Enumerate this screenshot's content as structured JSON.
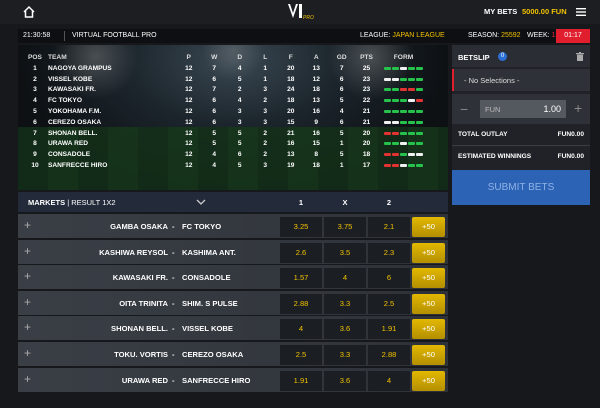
{
  "nav": {
    "my_bets": "MY BETS",
    "balance": "5000.00 FUN",
    "logo_sub": "PRO"
  },
  "header": {
    "clock": "21:30:58",
    "title": "VIRTUAL FOOTBALL PRO",
    "league_label": "LEAGUE:",
    "league_value": "JAPAN LEAGUE",
    "season_label": "SEASON:",
    "season_value": "25592",
    "week_label": "WEEK:",
    "week_value": "13",
    "timer": "01:17"
  },
  "league_table": {
    "headers": [
      "POS",
      "TEAM",
      "P",
      "W",
      "D",
      "L",
      "F",
      "A",
      "GD",
      "PTS",
      "FORM"
    ],
    "rows": [
      {
        "pos": "1",
        "team": "NAGOYA GRAMPUS",
        "p": "12",
        "w": "7",
        "d": "4",
        "l": "1",
        "f": "20",
        "a": "13",
        "gd": "7",
        "pts": "25",
        "form": [
          "W",
          "W",
          "D",
          "W",
          "W"
        ]
      },
      {
        "pos": "2",
        "team": "VISSEL KOBE",
        "p": "12",
        "w": "6",
        "d": "5",
        "l": "1",
        "f": "18",
        "a": "12",
        "gd": "6",
        "pts": "23",
        "form": [
          "D",
          "D",
          "W",
          "W",
          "W"
        ]
      },
      {
        "pos": "3",
        "team": "KAWASAKI FR.",
        "p": "12",
        "w": "7",
        "d": "2",
        "l": "3",
        "f": "24",
        "a": "18",
        "gd": "6",
        "pts": "23",
        "form": [
          "W",
          "W",
          "L",
          "L",
          "W"
        ]
      },
      {
        "pos": "4",
        "team": "FC TOKYO",
        "p": "12",
        "w": "6",
        "d": "4",
        "l": "2",
        "f": "18",
        "a": "13",
        "gd": "5",
        "pts": "22",
        "form": [
          "W",
          "W",
          "W",
          "D",
          "L"
        ]
      },
      {
        "pos": "5",
        "team": "YOKOHAMA F.M.",
        "p": "12",
        "w": "6",
        "d": "3",
        "l": "3",
        "f": "20",
        "a": "16",
        "gd": "4",
        "pts": "21",
        "form": [
          "W",
          "W",
          "W",
          "W",
          "W"
        ]
      },
      {
        "pos": "6",
        "team": "CEREZO OSAKA",
        "p": "12",
        "w": "6",
        "d": "3",
        "l": "3",
        "f": "15",
        "a": "9",
        "gd": "6",
        "pts": "21",
        "form": [
          "D",
          "D",
          "W",
          "W",
          "W"
        ]
      },
      {
        "pos": "7",
        "team": "SHONAN BELL.",
        "p": "12",
        "w": "5",
        "d": "5",
        "l": "2",
        "f": "21",
        "a": "16",
        "gd": "5",
        "pts": "20",
        "form": [
          "L",
          "L",
          "W",
          "W",
          "W"
        ]
      },
      {
        "pos": "8",
        "team": "URAWA RED",
        "p": "12",
        "w": "5",
        "d": "5",
        "l": "2",
        "f": "16",
        "a": "15",
        "gd": "1",
        "pts": "20",
        "form": [
          "W",
          "W",
          "D",
          "W",
          "W"
        ]
      },
      {
        "pos": "9",
        "team": "CONSADOLE",
        "p": "12",
        "w": "4",
        "d": "6",
        "l": "2",
        "f": "13",
        "a": "8",
        "gd": "5",
        "pts": "18",
        "form": [
          "L",
          "L",
          "W",
          "D",
          "D"
        ]
      },
      {
        "pos": "10",
        "team": "SANFRECCE HIRO",
        "p": "12",
        "w": "4",
        "d": "5",
        "l": "3",
        "f": "19",
        "a": "18",
        "gd": "1",
        "pts": "17",
        "form": [
          "L",
          "L",
          "D",
          "W",
          "W"
        ]
      }
    ]
  },
  "markets": {
    "title": "MARKETS",
    "subtitle": "| RESULT 1X2",
    "col1": "1",
    "colx": "X",
    "col2": "2",
    "rows": [
      {
        "home": "GAMBA OSAKA",
        "away": "FC TOKYO",
        "o1": "3.25",
        "ox": "3.75",
        "o2": "2.1",
        "more": "+50"
      },
      {
        "home": "KASHIWA REYSOL",
        "away": "KASHIMA ANT.",
        "o1": "2.6",
        "ox": "3.5",
        "o2": "2.3",
        "more": "+50"
      },
      {
        "home": "KAWASAKI FR.",
        "away": "CONSADOLE",
        "o1": "1.57",
        "ox": "4",
        "o2": "6",
        "more": "+50"
      },
      {
        "home": "OITA TRINITA",
        "away": "SHIM. S PULSE",
        "o1": "2.88",
        "ox": "3.3",
        "o2": "2.5",
        "more": "+50"
      },
      {
        "home": "SHONAN BELL.",
        "away": "VISSEL KOBE",
        "o1": "4",
        "ox": "3.6",
        "o2": "1.91",
        "more": "+50"
      },
      {
        "home": "TOKU. VORTIS",
        "away": "CEREZO OSAKA",
        "o1": "2.5",
        "ox": "3.3",
        "o2": "2.88",
        "more": "+50"
      },
      {
        "home": "URAWA RED",
        "away": "SANFRECCE HIRO",
        "o1": "1.91",
        "ox": "3.6",
        "o2": "4",
        "more": "+50"
      }
    ]
  },
  "betslip": {
    "title": "BETSLIP",
    "count": "0",
    "selection": "- No Selections -",
    "currency": "FUN",
    "stake": "1.00",
    "total_outlay_label": "TOTAL OUTLAY",
    "total_outlay_value": "FUN0.00",
    "est_win_label": "ESTIMATED WINNINGS",
    "est_win_value": "FUN0.00",
    "submit": "SUBMIT BETS"
  },
  "colors": {
    "accent": "#f2c200",
    "timer": "#e01e2e",
    "submit": "#2c63b4",
    "form_win": "#27c24c",
    "form_loss": "#e23232",
    "form_draw": "#f0f0f0"
  },
  "icons": [
    "home-icon",
    "menu-icon",
    "chevron-down-icon",
    "trash-icon",
    "plus-icon",
    "minus-icon"
  ]
}
